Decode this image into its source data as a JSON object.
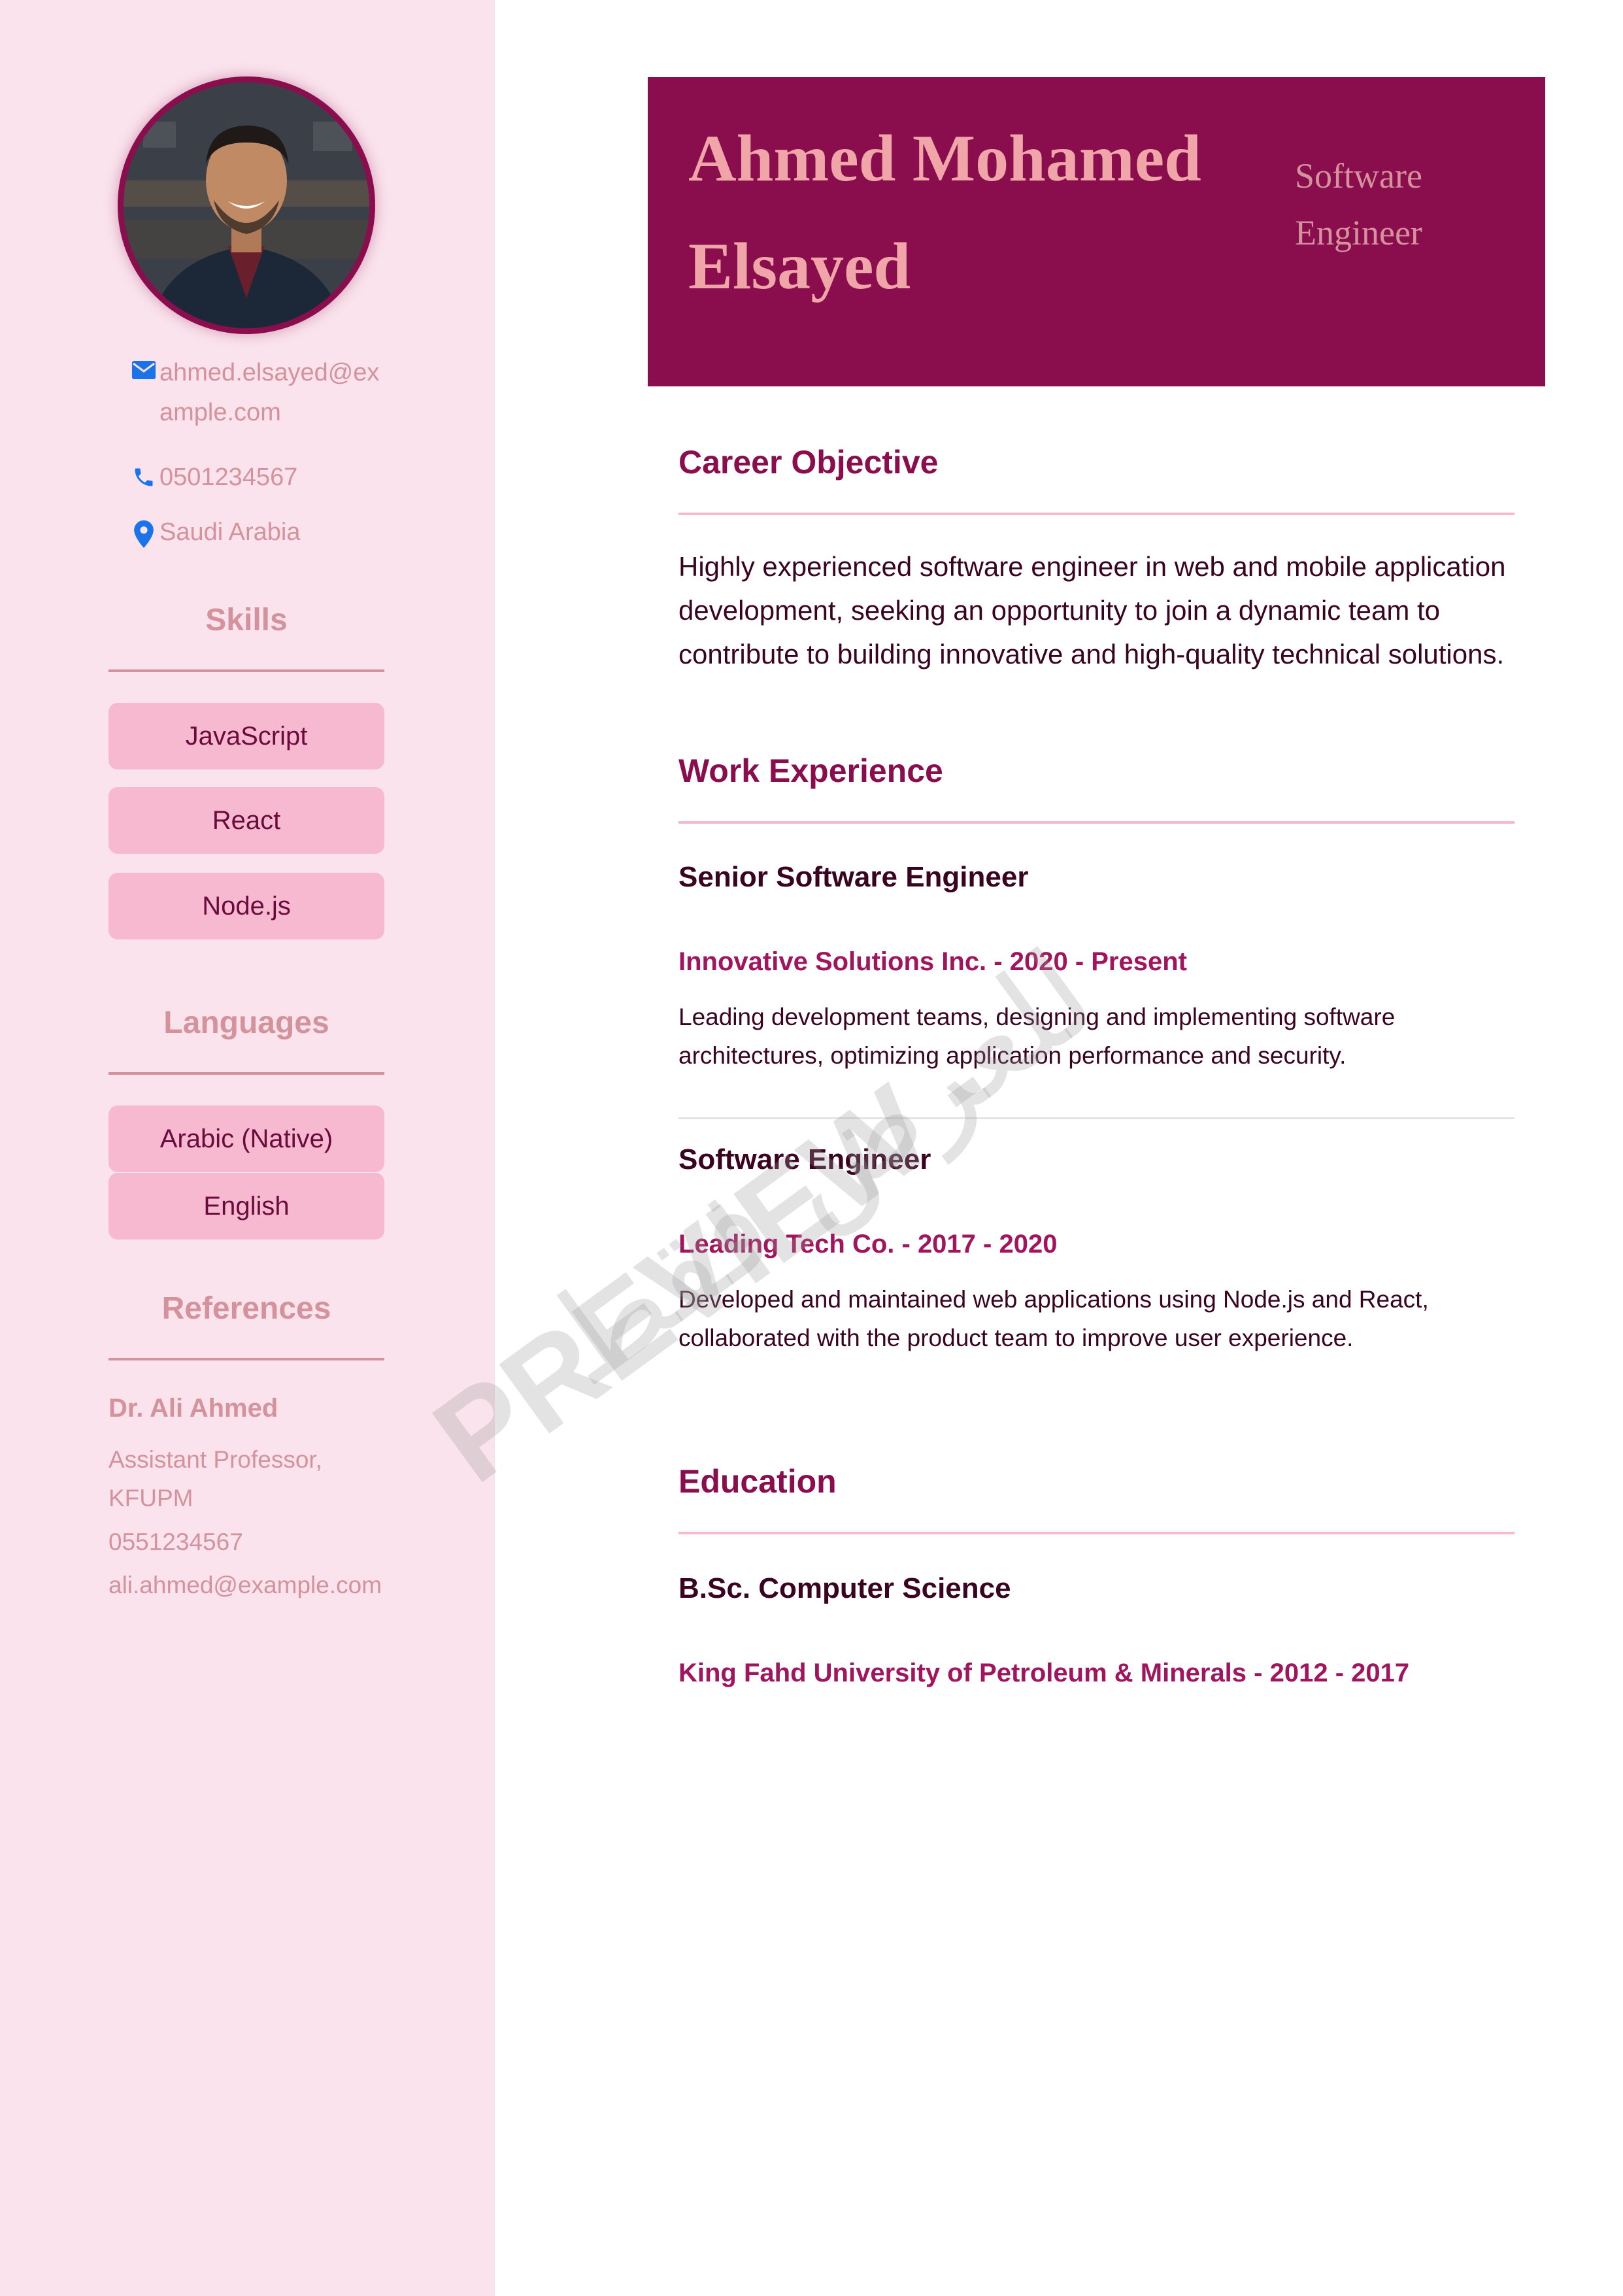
{
  "profile": {
    "name_line1": "Ahmed Mohamed",
    "name_line2": "Elsayed",
    "role_line1": "Software",
    "role_line2": "Engineer"
  },
  "contact": {
    "email": "ahmed.elsayed@example.com",
    "phone": "0501234567",
    "location": "Saudi Arabia"
  },
  "skills": {
    "heading": "Skills",
    "items": [
      "JavaScript",
      "React",
      "Node.js"
    ]
  },
  "languages": {
    "heading": "Languages",
    "items": [
      "Arabic (Native)",
      "English"
    ]
  },
  "references": {
    "heading": "References",
    "name": "Dr. Ali Ahmed",
    "title_line1": "Assistant Professor,",
    "title_line2": "KFUPM",
    "phone": "0551234567",
    "email": "ali.ahmed@example.com"
  },
  "objective": {
    "heading": "Career Objective",
    "lines": [
      "Highly experienced software engineer in web and mobile application",
      "development, seeking an opportunity to join a dynamic team to",
      "contribute to building innovative and high-quality technical solutions."
    ]
  },
  "experience": {
    "heading": "Work Experience",
    "jobs": [
      {
        "title": "Senior Software Engineer",
        "company": "Innovative Solutions Inc. - 2020 - Present",
        "desc_lines": [
          "Leading development teams, designing and implementing software",
          "architectures, optimizing application performance and security."
        ]
      },
      {
        "title": "Software Engineer",
        "company": "Leading Tech Co. - 2017 - 2020",
        "desc_lines": [
          "Developed and maintained web applications using Node.js and React,",
          "collaborated with the product team to improve user experience."
        ]
      }
    ]
  },
  "education": {
    "heading": "Education",
    "degree": "B.Sc. Computer Science",
    "school": "King Fahd University of Petroleum & Minerals - 2012 - 2017"
  },
  "watermark": {
    "text": "PREVIEW -",
    "arabic": "للعرض فقط"
  },
  "colors": {
    "sidebar_bg": "#fae3ec",
    "accent": "#8a0e4e",
    "pill": "#f6b9cf",
    "muted": "#d4939c",
    "icon_blue": "#1a73e8"
  },
  "icons": {
    "email": "envelope-icon",
    "phone": "phone-icon",
    "location": "map-pin-icon"
  }
}
